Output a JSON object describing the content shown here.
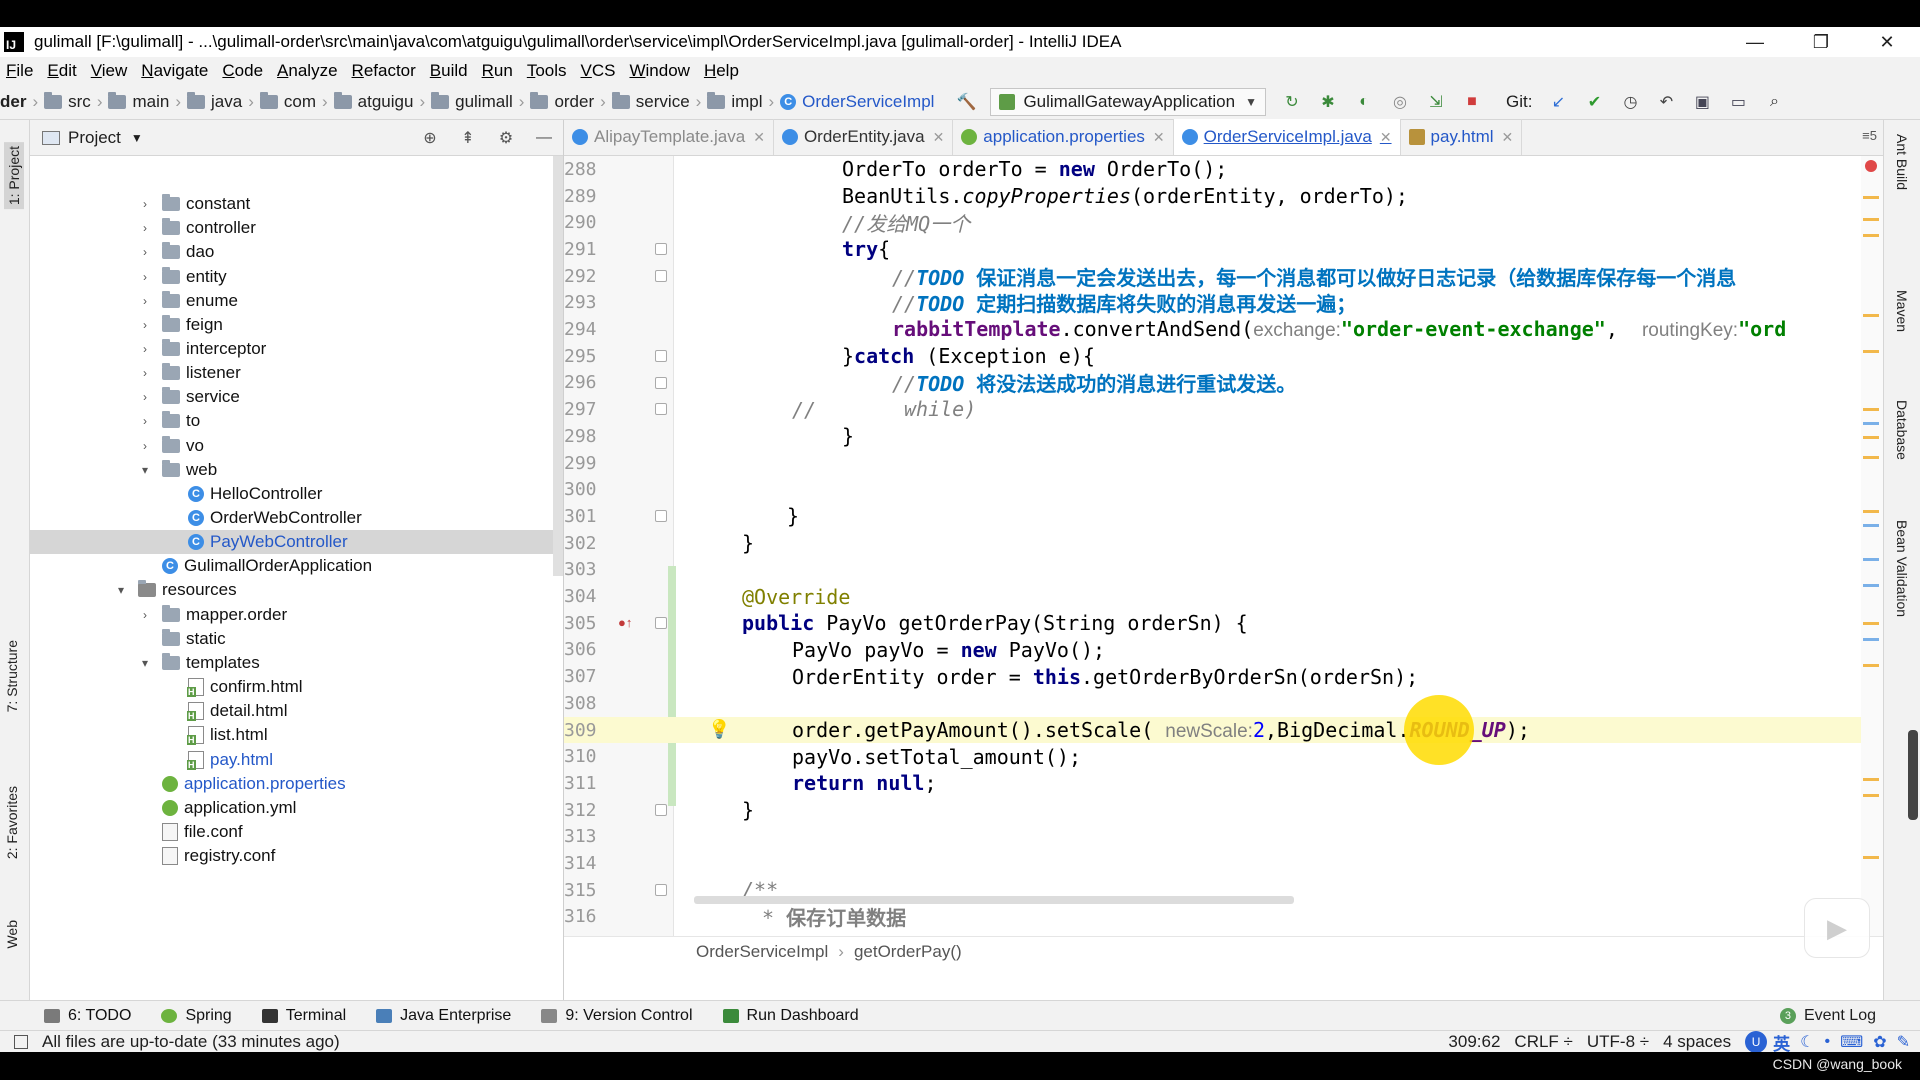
{
  "window": {
    "title": "gulimall [F:\\gulimall] - ...\\gulimall-order\\src\\main\\java\\com\\atguigu\\gulimall\\order\\service\\impl\\OrderServiceImpl.java [gulimall-order] - IntelliJ IDEA",
    "logo": "IJ",
    "controls": [
      "—",
      "❐",
      "✕"
    ]
  },
  "menu": [
    "File",
    "Edit",
    "View",
    "Navigate",
    "Code",
    "Analyze",
    "Refactor",
    "Build",
    "Run",
    "Tools",
    "VCS",
    "Window",
    "Help"
  ],
  "nav": {
    "first": "der",
    "crumbs": [
      "src",
      "main",
      "java",
      "com",
      "atguigu",
      "gulimall",
      "order",
      "service",
      "impl"
    ],
    "class_crumb": "OrderServiceImpl",
    "run_config": "GulimallGatewayApplication",
    "git_label": "Git:"
  },
  "left_strip": [
    "1: Project",
    "7: Structure",
    "2: Favorites",
    "Web"
  ],
  "project": {
    "header": "Project",
    "tree": [
      {
        "label": "constant",
        "kind": "folder",
        "indent": 1,
        "arrow": "›"
      },
      {
        "label": "controller",
        "kind": "folder",
        "indent": 1,
        "arrow": "›"
      },
      {
        "label": "dao",
        "kind": "folder",
        "indent": 1,
        "arrow": "›"
      },
      {
        "label": "entity",
        "kind": "folder",
        "indent": 1,
        "arrow": "›"
      },
      {
        "label": "enume",
        "kind": "folder",
        "indent": 1,
        "arrow": "›"
      },
      {
        "label": "feign",
        "kind": "folder",
        "indent": 1,
        "arrow": "›"
      },
      {
        "label": "interceptor",
        "kind": "folder",
        "indent": 1,
        "arrow": "›"
      },
      {
        "label": "listener",
        "kind": "folder",
        "indent": 1,
        "arrow": "›"
      },
      {
        "label": "service",
        "kind": "folder",
        "indent": 1,
        "arrow": "›"
      },
      {
        "label": "to",
        "kind": "folder",
        "indent": 1,
        "arrow": "›"
      },
      {
        "label": "vo",
        "kind": "folder",
        "indent": 1,
        "arrow": "›"
      },
      {
        "label": "web",
        "kind": "folder",
        "indent": 1,
        "arrow": "⌄"
      },
      {
        "label": "HelloController",
        "kind": "class",
        "indent": 2,
        "arrow": ""
      },
      {
        "label": "OrderWebController",
        "kind": "class",
        "indent": 2,
        "arrow": ""
      },
      {
        "label": "PayWebController",
        "kind": "class",
        "indent": 2,
        "arrow": "",
        "selected": true
      },
      {
        "label": "GulimallOrderApplication",
        "kind": "class",
        "indent": 1,
        "arrow": ""
      },
      {
        "label": "resources",
        "kind": "res",
        "indent": 0,
        "arrow": "⌄"
      },
      {
        "label": "mapper.order",
        "kind": "folder",
        "indent": 1,
        "arrow": "›"
      },
      {
        "label": "static",
        "kind": "folder",
        "indent": 1,
        "arrow": ""
      },
      {
        "label": "templates",
        "kind": "folder",
        "indent": 1,
        "arrow": "⌄"
      },
      {
        "label": "confirm.html",
        "kind": "html",
        "indent": 2,
        "arrow": ""
      },
      {
        "label": "detail.html",
        "kind": "html",
        "indent": 2,
        "arrow": ""
      },
      {
        "label": "list.html",
        "kind": "html",
        "indent": 2,
        "arrow": ""
      },
      {
        "label": "pay.html",
        "kind": "html",
        "indent": 2,
        "arrow": "",
        "blue": true
      },
      {
        "label": "application.properties",
        "kind": "spring",
        "indent": 1,
        "arrow": "",
        "blue": true
      },
      {
        "label": "application.yml",
        "kind": "spring",
        "indent": 1,
        "arrow": ""
      },
      {
        "label": "file.conf",
        "kind": "conf",
        "indent": 1,
        "arrow": ""
      },
      {
        "label": "registry.conf",
        "kind": "conf",
        "indent": 1,
        "arrow": ""
      }
    ]
  },
  "tabs": [
    {
      "label": "AlipayTemplate.java",
      "icon": "c",
      "style": "gray"
    },
    {
      "label": "OrderEntity.java",
      "icon": "c",
      "style": ""
    },
    {
      "label": "application.properties",
      "icon": "s",
      "style": "spring"
    },
    {
      "label": "OrderServiceImpl.java",
      "icon": "c",
      "style": "active"
    },
    {
      "label": "pay.html",
      "icon": "h",
      "style": "spring"
    }
  ],
  "tabs_more": "≡5",
  "code": {
    "line_numbers": [
      "288",
      "289",
      "290",
      "291",
      "292",
      "293",
      "294",
      "295",
      "296",
      "297",
      "298",
      "299",
      "300",
      "301",
      "302",
      "303",
      "304",
      "305",
      "306",
      "307",
      "308",
      "309",
      "310",
      "311",
      "312",
      "313",
      "314",
      "315",
      "316"
    ],
    "l288": [
      "OrderTo orderTo = ",
      "new",
      " OrderTo();"
    ],
    "l289": [
      "BeanUtils.",
      "copyProperties",
      "(orderEntity, orderTo);"
    ],
    "l290": "//发给MQ一个",
    "l291": [
      "try",
      "{"
    ],
    "l292": [
      "//",
      "TODO",
      " 保证消息一定会发送出去，每一个消息都可以做好日志记录（给数据库保存每一个消息"
    ],
    "l293": [
      "//",
      "TODO",
      " 定期扫描数据库将失败的消息再发送一遍；"
    ],
    "l294": [
      "rabbitTemplate",
      ".convertAndSend(",
      "exchange:",
      "\"order-event-exchange\"",
      ",  ",
      "routingKey:",
      "\"ord"
    ],
    "l295": [
      "}",
      "catch",
      " (Exception e){"
    ],
    "l296": [
      "//",
      "TODO",
      " 将没法送成功的消息进行重试发送。"
    ],
    "l297a": "//",
    "l297b": "while)",
    "l298": "}",
    "l301": "}",
    "l302": "}",
    "l304": "@Override",
    "l305": [
      "public",
      " PayVo getOrderPay(String orderSn) {"
    ],
    "l306": [
      "PayVo payVo = ",
      "new",
      " PayVo();"
    ],
    "l307": [
      "OrderEntity order = ",
      "this",
      ".getOrderByOrderSn(orderSn);"
    ],
    "l309": [
      "order.getPayAmount().setScale( ",
      "newScale:",
      "2",
      ",BigDecimal.",
      "ROUND_UP",
      ");"
    ],
    "l310": "payVo.setTotal_amount();",
    "l311": [
      "return null",
      ";"
    ],
    "l312": "}",
    "l315": "/**",
    "l316": [
      "* ",
      "保存订单数据"
    ]
  },
  "editor_breadcrumb": [
    "OrderServiceImpl",
    "getOrderPay()"
  ],
  "right_strip": [
    "Ant Build",
    "Maven",
    "Database",
    "Bean Validation"
  ],
  "bottom_tools": [
    "6: TODO",
    "Spring",
    "Terminal",
    "Java Enterprise",
    "9: Version Control",
    "Run Dashboard"
  ],
  "event_log": {
    "badge": "3",
    "label": "Event Log"
  },
  "status": {
    "message": "All files are up-to-date (33 minutes ago)",
    "position": "309:62",
    "line_sep": "CRLF ÷",
    "encoding": "UTF-8 ÷",
    "indent": "4 spaces",
    "ime_lang": "英",
    "ime_u": "U"
  },
  "watermark": "CSDN @wang_book"
}
